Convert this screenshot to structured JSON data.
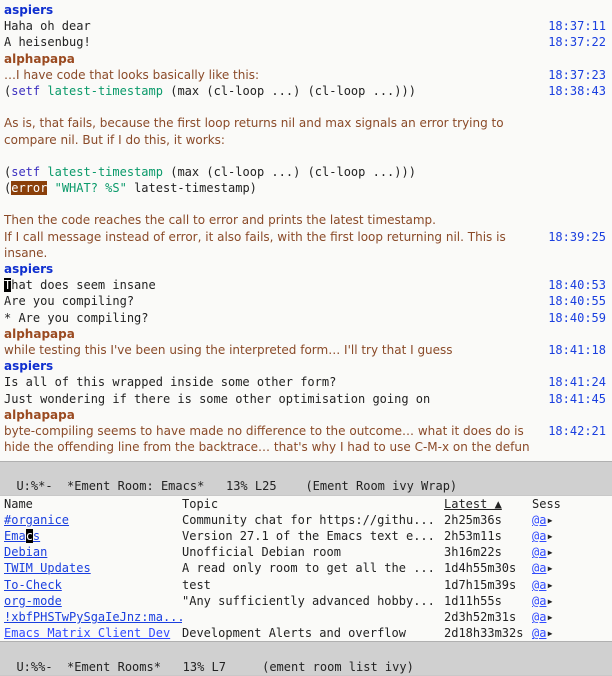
{
  "chat": {
    "messages": [
      {
        "nick": "aspiers",
        "nick_class": "nick",
        "lines": [
          {
            "text": "Haha oh dear",
            "cls": "mono",
            "ts": "18:37:11"
          },
          {
            "text": "A heisenbug!",
            "cls": "mono",
            "ts": "18:37:22"
          }
        ]
      },
      {
        "nick": "alphapapa",
        "nick_class": "nick2",
        "lines": [
          {
            "text": "…I have code that looks basically like this:",
            "cls": "prose",
            "ts": "18:37:23"
          }
        ]
      },
      {
        "code1": {
          "setf": "setf",
          "latest": "latest-timestamp",
          "max": "max",
          "loop": "cl-loop",
          "dots": "...",
          "ts": "18:38:43"
        }
      },
      {
        "blank": true
      },
      {
        "para": [
          {
            "text": "As is, that fails, because the first loop returns nil and max signals an error trying to"
          },
          {
            "text": "compare nil. But if I do this, it works:"
          }
        ],
        "cls": "prose"
      },
      {
        "blank": true
      },
      {
        "code1": {
          "setf": "setf",
          "latest": "latest-timestamp",
          "max": "max",
          "loop": "cl-loop",
          "dots": "..."
        }
      },
      {
        "code2": {
          "err": "error",
          "str": "\"WHAT? %S\"",
          "arg": "latest-timestamp"
        }
      },
      {
        "blank": true
      },
      {
        "para": [
          {
            "text": "Then the code reaches the call to error and prints the latest timestamp."
          },
          {
            "text": "If I call message instead of error, it also fails, with the first loop returning nil. This is",
            "ts": "18:39:25"
          },
          {
            "text": "insane."
          }
        ],
        "cls": "prose"
      },
      {
        "nick": "aspiers",
        "nick_class": "nick",
        "lines": [
          {
            "cursor": "T",
            "text": "hat does seem insane",
            "cls": "mono",
            "ts": "18:40:53"
          },
          {
            "text": "Are you compiling?",
            "cls": "mono",
            "ts": "18:40:55"
          },
          {
            "text": " * Are you compiling?",
            "cls": "mono",
            "ts": "18:40:59"
          }
        ]
      },
      {
        "nick": "alphapapa",
        "nick_class": "nick2",
        "lines": [
          {
            "text": "while testing this I've been using the interpreted form… I'll try that I guess",
            "cls": "prose",
            "ts": "18:41:18"
          }
        ]
      },
      {
        "nick": "aspiers",
        "nick_class": "nick",
        "lines": [
          {
            "text": "Is all of this wrapped inside some other form?",
            "cls": "mono",
            "ts": "18:41:24"
          },
          {
            "text": "Just wondering if there is some other optimisation going on",
            "cls": "mono",
            "ts": "18:41:45"
          }
        ]
      },
      {
        "nick": "alphapapa",
        "nick_class": "nick2",
        "lines": [
          {
            "text": "byte-compiling seems to have made no difference to the outcome… what it does do is",
            "cls": "prose",
            "ts": "18:42:21"
          },
          {
            "text": "hide the offending line from the backtrace… that's why I had to use C-M-x on the defun",
            "cls": "prose"
          }
        ]
      }
    ]
  },
  "modeline_chat": "U:%*-  *Ement Room: Emacs*   13% L25    (Ement Room ivy Wrap)",
  "rooms": {
    "headers": {
      "name": "Name",
      "topic": "Topic",
      "latest": "Latest ▲",
      "sess": "Sess"
    },
    "rows": [
      {
        "name": "#organice",
        "topic": "Community chat for https://githu...",
        "latest": "2h25m36s",
        "sess": "@a",
        "link": true
      },
      {
        "name": "Emacs",
        "topic": "Version 27.1 of the Emacs text e...",
        "latest": "2h53m11s",
        "sess": "@a",
        "link": true,
        "cursor_at": 3
      },
      {
        "name": "Debian",
        "topic": "Unofficial Debian room",
        "latest": "3h16m22s",
        "sess": "@a",
        "link": true,
        "nolink": true
      },
      {
        "name": "TWIM Updates",
        "topic": "A read only room to get all the ...",
        "latest": "1d4h55m30s",
        "sess": "@a",
        "link": true
      },
      {
        "name": "To-Check",
        "topic": "test",
        "latest": "1d7h15m39s",
        "sess": "@a",
        "link": true
      },
      {
        "name": "org-mode",
        "topic": "\"Any sufficiently advanced hobby...",
        "latest": "1d11h55s",
        "sess": "@a",
        "link": true
      },
      {
        "name": "!xbfPHSTwPySgaIeJnz:ma...",
        "topic": "",
        "latest": "2d3h52m31s",
        "sess": "@a",
        "link": true
      },
      {
        "name": "Emacs Matrix Client Dev",
        "topic": "Development Alerts and overflow",
        "latest": "2d18h33m32s",
        "sess": "@a",
        "link": true,
        "truncated": true
      }
    ]
  },
  "modeline_rooms": "U:%%-  *Ement Rooms*   13% L7     (ement room list ivy)"
}
